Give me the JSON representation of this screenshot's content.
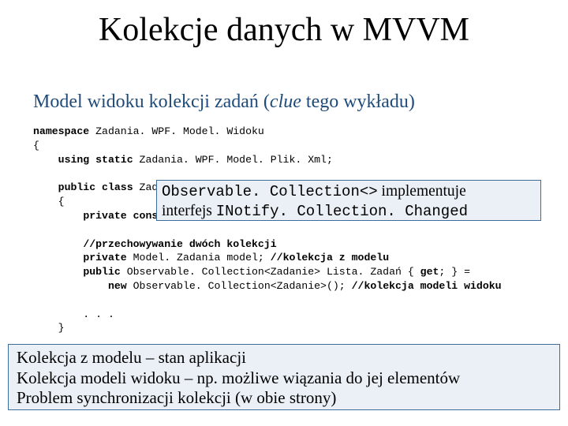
{
  "title": "Kolekcje danych w MVVM",
  "subtitle_plain1": "Model widoku kolekcji zadań (",
  "subtitle_italic": "clue",
  "subtitle_plain2": " tego wykładu)",
  "code": {
    "l01a": "namespace",
    "l01b": " Zadania. WPF. Model. Widoku",
    "l02": "{",
    "l03a": "    ",
    "l03b": "using static",
    "l03c": " Zadania. WPF. Model. Plik. Xml;",
    "l04": "",
    "l05a": "    ",
    "l05b": "public class",
    "l05c": " Zadania",
    "l06": "    {",
    "l07a": "        ",
    "l07b": "private const",
    "l08": "",
    "l09a": "        ",
    "l09b": "//przechowywanie dwóch kolekcji",
    "l10a": "        ",
    "l10b": "private",
    "l10c": " Model. Zadania model; ",
    "l10d": "//kolekcja z modelu",
    "l11a": "        ",
    "l11b": "public",
    "l11c": " Observable. Collection<Zadanie> Lista. Zadań { ",
    "l11d": "get",
    "l11e": "; } =",
    "l12a": "            ",
    "l12b": "new",
    "l12c": " Observable. Collection<Zadanie>(); ",
    "l12d": "//kolekcja modeli widoku",
    "l13": "",
    "l14": "        . . .",
    "l15": "    }"
  },
  "overlay": {
    "mono1": "Observable. Collection<>",
    "plain1": " implementuje",
    "plain2": "interfejs ",
    "mono2": "INotify. Collection. Changed"
  },
  "notes": {
    "line1": "Kolekcja z modelu – stan aplikacji",
    "line2": "Kolekcja modeli widoku – np. możliwe wiązania do jej elementów",
    "line3": "Problem synchronizacji kolekcji (w obie strony)"
  }
}
